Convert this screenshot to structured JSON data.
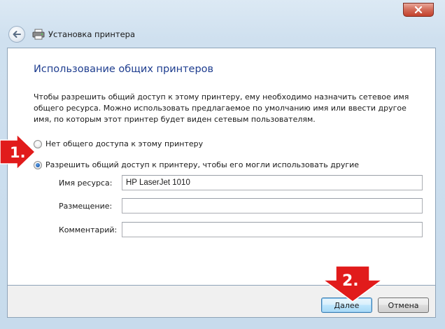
{
  "window": {
    "title": "Установка принтера"
  },
  "page": {
    "heading": "Использование общих принтеров",
    "description": "Чтобы разрешить общий доступ к этому принтеру, ему необходимо назначить сетевое имя общего ресурса. Можно использовать предлагаемое по умолчанию имя или ввести другое имя, по которым этот принтер будет виден сетевым пользователям."
  },
  "options": [
    {
      "label": "Нет общего доступа к этому принтеру",
      "selected": false
    },
    {
      "label": "Разрешить общий доступ к принтеру, чтобы его могли использовать другие",
      "selected": true
    }
  ],
  "fields": {
    "share_name": {
      "label": "Имя ресурса:",
      "value": "HP LaserJet 1010"
    },
    "location": {
      "label": "Размещение:",
      "value": ""
    },
    "comment": {
      "label": "Комментарий:",
      "value": ""
    }
  },
  "buttons": {
    "next": "Далее",
    "cancel": "Отмена"
  },
  "annotations": {
    "marker_1": "1.",
    "marker_2": "2."
  },
  "colors": {
    "heading": "#1e3d8f",
    "annotation_red": "#e11b1b",
    "close_button": "#c3412c"
  }
}
